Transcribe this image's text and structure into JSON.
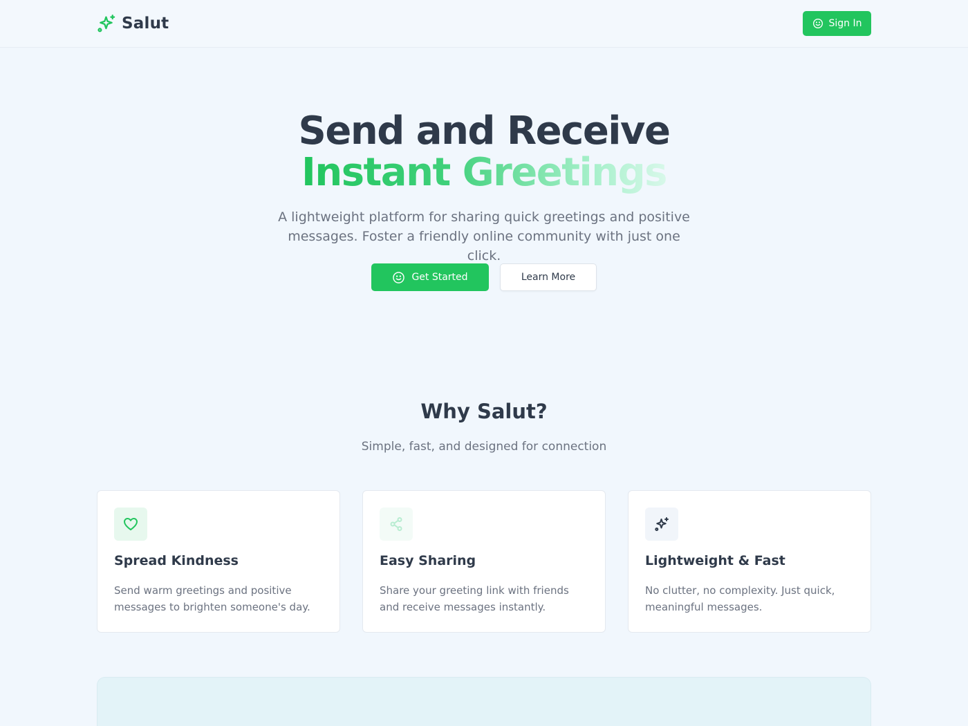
{
  "header": {
    "brand": "Salut",
    "sign_in": "Sign In"
  },
  "hero": {
    "title_line1": "Send and Receive",
    "title_line2": "Instant Greetings",
    "subtitle": "A lightweight platform for sharing quick greetings and positive messages. Foster a friendly online community with just one click.",
    "primary_button": "Get Started",
    "secondary_button": "Learn More"
  },
  "why": {
    "title": "Why Salut?",
    "subtitle": "Simple, fast, and designed for connection",
    "cards": [
      {
        "icon": "heart-icon",
        "title": "Spread Kindness",
        "text": "Send warm greetings and positive messages to brighten someone's day."
      },
      {
        "icon": "share-icon",
        "title": "Easy Sharing",
        "text": "Share your greeting link with friends and receive messages instantly."
      },
      {
        "icon": "sparkles-icon",
        "title": "Lightweight & Fast",
        "text": "No clutter, no complexity. Just quick, meaningful messages."
      }
    ]
  },
  "colors": {
    "accent": "#22c55e",
    "background": "#f1f7fd",
    "text_dark": "#2f3a4a",
    "text_muted": "#6b7280"
  }
}
